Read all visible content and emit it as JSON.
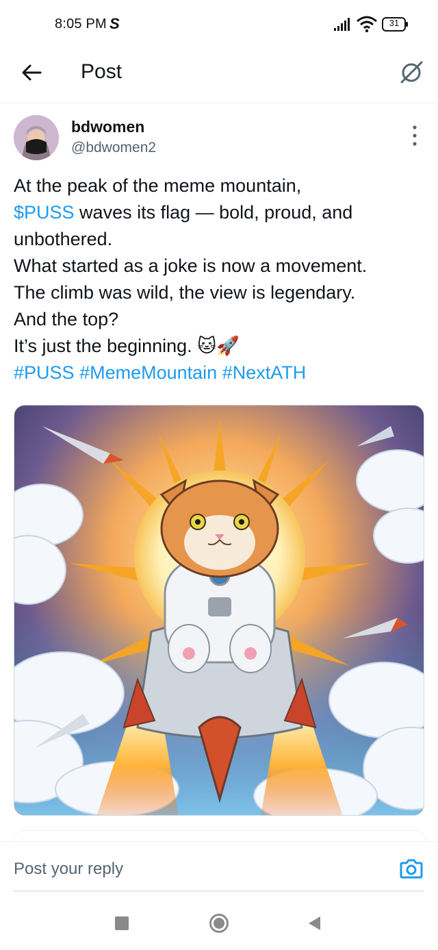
{
  "status_bar": {
    "time": "8:05 PM",
    "carrier_glyph": "S",
    "battery": "31",
    "icons": [
      "signal-icon",
      "wifi-icon",
      "battery-icon"
    ]
  },
  "header": {
    "title": "Post",
    "icons": [
      "back-arrow-icon",
      "grok-icon"
    ]
  },
  "post": {
    "author": {
      "name": "bdwomen",
      "handle": "@bdwomen2"
    },
    "text": {
      "line1": "At the peak of the meme mountain,",
      "line2_link": "$PUSS",
      "line2_rest": " waves its flag — bold, proud, and",
      "line3": "unbothered.",
      "line4": "What started as a joke is now a movement.",
      "line5": "The climb was wild, the view is legendary.",
      "line6": "And the top?",
      "line7": "It’s just the beginning. 🐱🚀",
      "hashtag1": "#PUSS",
      "hashtag2": "#MemeMountain",
      "hashtag3": "#NextATH"
    },
    "image_icon": "cat-astronaut-rocket-image"
  },
  "reply": {
    "placeholder": "Post your reply",
    "icon": "camera-icon"
  },
  "nav": {
    "icons": [
      "recents-square-icon",
      "home-circle-icon",
      "back-triangle-icon"
    ]
  },
  "colors": {
    "link": "#1d9bf0",
    "text": "#0f1419",
    "secondary": "#536471"
  }
}
